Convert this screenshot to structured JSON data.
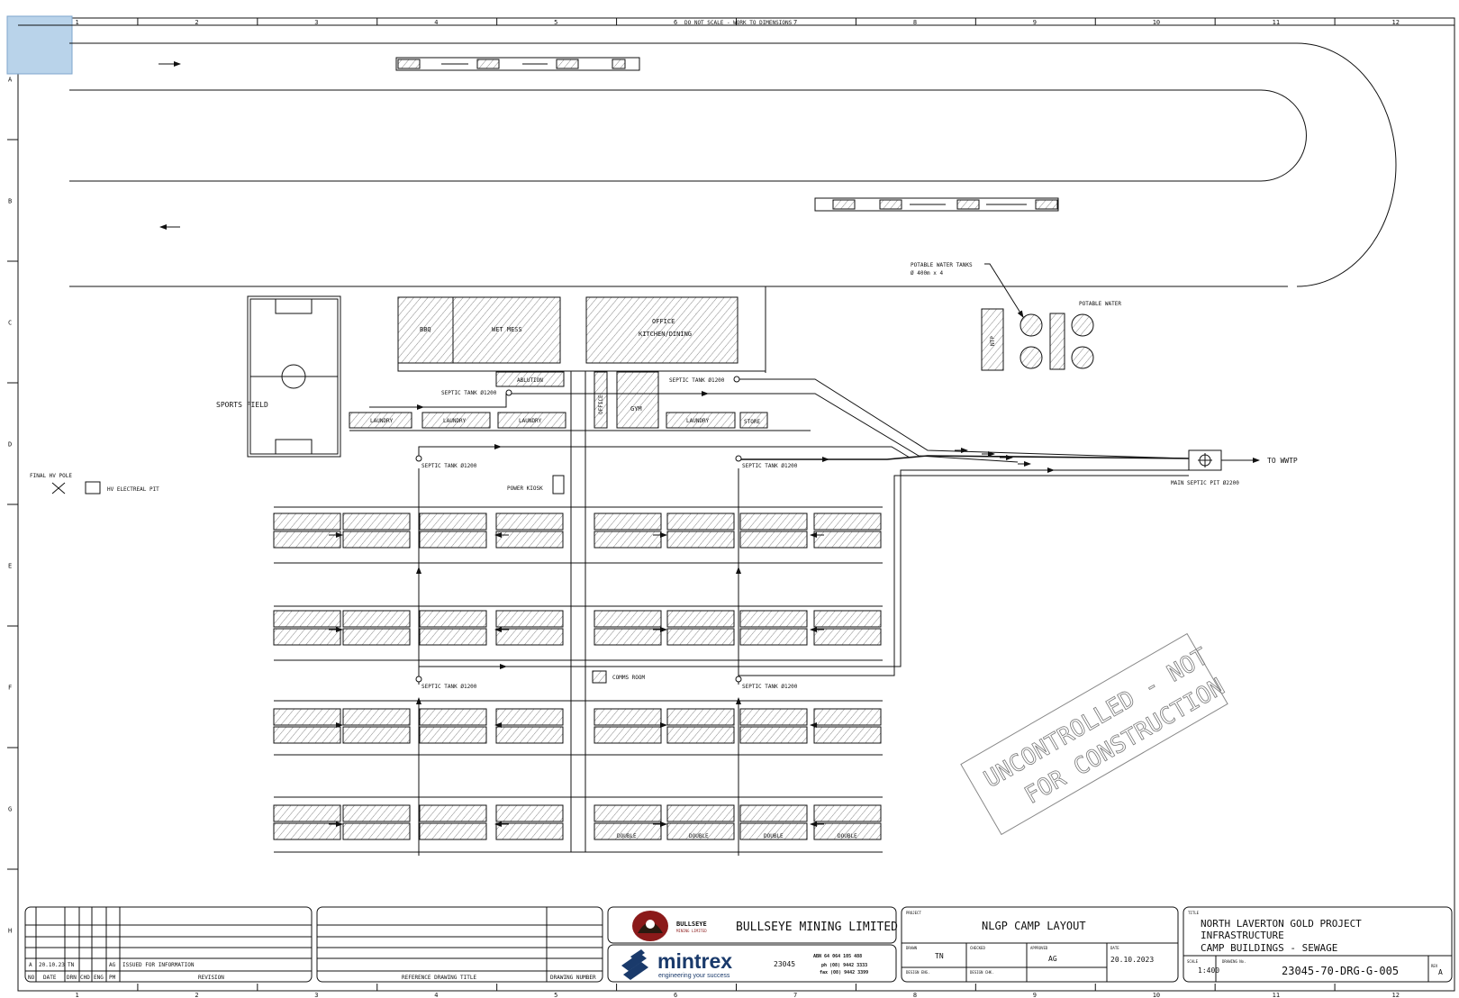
{
  "grid": {
    "columns": [
      "1",
      "2",
      "3",
      "4",
      "5",
      "6",
      "7",
      "8",
      "9",
      "10",
      "11",
      "12"
    ],
    "rows": [
      "A",
      "B",
      "C",
      "D",
      "E",
      "F",
      "G",
      "H"
    ]
  },
  "notes": {
    "scale_note": "DO NOT SCALE - WORK TO DIMENSIONS",
    "watermark_line1": "UNCONTROLLED - NOT",
    "watermark_line2": "FOR CONSTRUCTION"
  },
  "labels": {
    "sports_field": "SPORTS FIELD",
    "final_hv_pole": "FINAL HV POLE",
    "hv_electrical_pit": "HV ELECTREAL PIT",
    "power_kiosk": "POWER KIOSK",
    "potable_water_tanks": "POTABLE WATER TANKS",
    "potable_water_tanks_qty": "Ø 400m x 4",
    "potable_water": "POTABLE WATER",
    "bbq": "BBQ",
    "wet_mess": "WET MESS",
    "ablution": "ABLUTION",
    "office": "OFFICE",
    "kitchen_dining": "KITCHEN/DINING",
    "office_small": "OFFICE",
    "gym": "GYM",
    "laundry": "LAUNDRY",
    "store": "STORE",
    "comms_room": "COMMS ROOM",
    "double": "DOUBLE",
    "septic_tank": "SEPTIC TANK Ø1200",
    "main_septic_pit": "MAIN SEPTIC PIT Ø2200",
    "to_wwtp": "TO WWTP",
    "tank_tag": "NTP"
  },
  "title_block": {
    "revision": {
      "rev": "A",
      "date": "20.10.23",
      "drawn": "TN",
      "checked": "AG",
      "description": "ISSUED FOR INFORMATION",
      "headers": [
        "NO",
        "DATE",
        "DRN",
        "CHD",
        "ENG",
        "PM",
        "REVISION"
      ]
    },
    "reference_title": "REFERENCE DRAWING TITLE",
    "drawing_number_header": "DRAWING NUMBER",
    "client_name": "BULLSEYE MINING LIMITED",
    "client_logo_text": "BULLSEYE",
    "client_logo_sub": "MINING LIMITED",
    "consultant_logo": "mintrex",
    "consultant_tagline": "engineering your success",
    "job_number": "23045",
    "abn": "ABN 64 064 105 488",
    "phone": "ph (08) 9442 3333",
    "fax": "fax (08) 9442 3399",
    "project_label": "PROJECT",
    "project": "NLGP CAMP LAYOUT",
    "drawn_label": "DRAWN",
    "drawn_by": "TN",
    "checked_label": "CHECKED",
    "approved_label": "APPROVED",
    "approved_by": "AG",
    "date_label": "DATE",
    "date": "20.10.2023",
    "design_eng_label": "DESIGN ENG.",
    "design_chk_label": "DESIGN CHK.",
    "title_label": "TITLE",
    "title_line1": "NORTH LAVERTON GOLD PROJECT",
    "title_line2": "INFRASTRUCTURE",
    "title_line3": "CAMP BUILDINGS - SEWAGE",
    "scale_label": "SCALE",
    "scale": "1:400",
    "drawing_no_label": "DRAWING No.",
    "drawing_no": "23045-70-DRG-G-005",
    "rev_label": "REV",
    "rev": "A"
  }
}
